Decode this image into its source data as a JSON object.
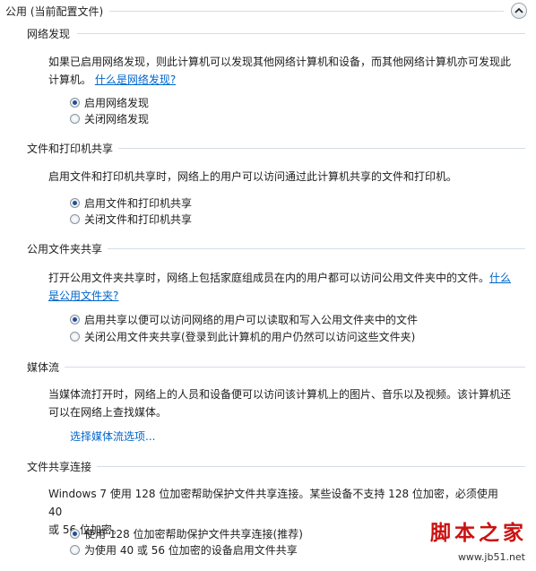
{
  "header": {
    "title": "公用 (当前配置文件)",
    "collapse_icon": "chevron-up-icon"
  },
  "sections": {
    "network_discovery": {
      "title": "网络发现",
      "desc_line1": "如果已启用网络发现，则此计算机可以发现其他网络计算机和设备，而其他网络计算机亦可发现此",
      "desc_line2": "计算机。",
      "help_link": "什么是网络发现?",
      "options": [
        {
          "label": "启用网络发现",
          "selected": true
        },
        {
          "label": "关闭网络发现",
          "selected": false
        }
      ]
    },
    "file_printer_sharing": {
      "title": "文件和打印机共享",
      "desc": "启用文件和打印机共享时，网络上的用户可以访问通过此计算机共享的文件和打印机。",
      "options": [
        {
          "label": "启用文件和打印机共享",
          "selected": true
        },
        {
          "label": "关闭文件和打印机共享",
          "selected": false
        }
      ]
    },
    "public_folder_sharing": {
      "title": "公用文件夹共享",
      "desc_line1": "打开公用文件夹共享时，网络上包括家庭组成员在内的用户都可以访问公用文件夹中的文件。",
      "help_link_part1": "什么",
      "help_link_part2": "是公用文件夹?",
      "options": [
        {
          "label": "启用共享以便可以访问网络的用户可以读取和写入公用文件夹中的文件",
          "selected": true
        },
        {
          "label": "关闭公用文件夹共享(登录到此计算机的用户仍然可以访问这些文件夹)",
          "selected": false
        }
      ]
    },
    "media_streaming": {
      "title": "媒体流",
      "desc_line1": "当媒体流打开时，网络上的人员和设备便可以访问该计算机上的图片、音乐以及视频。该计算机还",
      "desc_line2": "可以在网络上查找媒体。",
      "link": "选择媒体流选项..."
    },
    "file_sharing_connections": {
      "title": "文件共享连接",
      "desc_line1": "Windows 7 使用 128 位加密帮助保护文件共享连接。某些设备不支持 128 位加密，必须使用 40",
      "desc_line2": "或 56 位加密。",
      "options": [
        {
          "label": "使用 128 位加密帮助保护文件共享连接(推荐)",
          "selected": true
        },
        {
          "label": "为使用 40 或 56 位加密的设备启用文件共享",
          "selected": false
        }
      ]
    }
  },
  "watermark": {
    "logo": "脚本之家",
    "url": "www.jb51.net"
  }
}
